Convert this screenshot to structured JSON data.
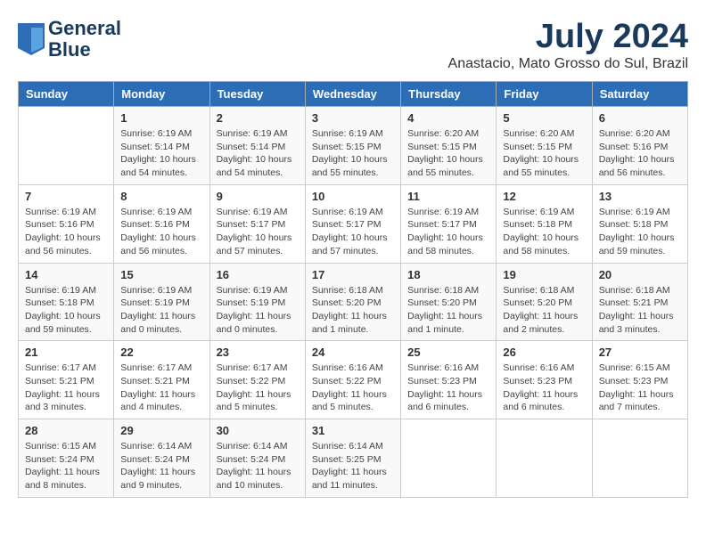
{
  "header": {
    "logo_line1": "General",
    "logo_line2": "Blue",
    "month": "July 2024",
    "location": "Anastacio, Mato Grosso do Sul, Brazil"
  },
  "columns": [
    "Sunday",
    "Monday",
    "Tuesday",
    "Wednesday",
    "Thursday",
    "Friday",
    "Saturday"
  ],
  "weeks": [
    [
      {
        "day": "",
        "sunrise": "",
        "sunset": "",
        "daylight": ""
      },
      {
        "day": "1",
        "sunrise": "Sunrise: 6:19 AM",
        "sunset": "Sunset: 5:14 PM",
        "daylight": "Daylight: 10 hours and 54 minutes."
      },
      {
        "day": "2",
        "sunrise": "Sunrise: 6:19 AM",
        "sunset": "Sunset: 5:14 PM",
        "daylight": "Daylight: 10 hours and 54 minutes."
      },
      {
        "day": "3",
        "sunrise": "Sunrise: 6:19 AM",
        "sunset": "Sunset: 5:15 PM",
        "daylight": "Daylight: 10 hours and 55 minutes."
      },
      {
        "day": "4",
        "sunrise": "Sunrise: 6:20 AM",
        "sunset": "Sunset: 5:15 PM",
        "daylight": "Daylight: 10 hours and 55 minutes."
      },
      {
        "day": "5",
        "sunrise": "Sunrise: 6:20 AM",
        "sunset": "Sunset: 5:15 PM",
        "daylight": "Daylight: 10 hours and 55 minutes."
      },
      {
        "day": "6",
        "sunrise": "Sunrise: 6:20 AM",
        "sunset": "Sunset: 5:16 PM",
        "daylight": "Daylight: 10 hours and 56 minutes."
      }
    ],
    [
      {
        "day": "7",
        "sunrise": "Sunrise: 6:19 AM",
        "sunset": "Sunset: 5:16 PM",
        "daylight": "Daylight: 10 hours and 56 minutes."
      },
      {
        "day": "8",
        "sunrise": "Sunrise: 6:19 AM",
        "sunset": "Sunset: 5:16 PM",
        "daylight": "Daylight: 10 hours and 56 minutes."
      },
      {
        "day": "9",
        "sunrise": "Sunrise: 6:19 AM",
        "sunset": "Sunset: 5:17 PM",
        "daylight": "Daylight: 10 hours and 57 minutes."
      },
      {
        "day": "10",
        "sunrise": "Sunrise: 6:19 AM",
        "sunset": "Sunset: 5:17 PM",
        "daylight": "Daylight: 10 hours and 57 minutes."
      },
      {
        "day": "11",
        "sunrise": "Sunrise: 6:19 AM",
        "sunset": "Sunset: 5:17 PM",
        "daylight": "Daylight: 10 hours and 58 minutes."
      },
      {
        "day": "12",
        "sunrise": "Sunrise: 6:19 AM",
        "sunset": "Sunset: 5:18 PM",
        "daylight": "Daylight: 10 hours and 58 minutes."
      },
      {
        "day": "13",
        "sunrise": "Sunrise: 6:19 AM",
        "sunset": "Sunset: 5:18 PM",
        "daylight": "Daylight: 10 hours and 59 minutes."
      }
    ],
    [
      {
        "day": "14",
        "sunrise": "Sunrise: 6:19 AM",
        "sunset": "Sunset: 5:18 PM",
        "daylight": "Daylight: 10 hours and 59 minutes."
      },
      {
        "day": "15",
        "sunrise": "Sunrise: 6:19 AM",
        "sunset": "Sunset: 5:19 PM",
        "daylight": "Daylight: 11 hours and 0 minutes."
      },
      {
        "day": "16",
        "sunrise": "Sunrise: 6:19 AM",
        "sunset": "Sunset: 5:19 PM",
        "daylight": "Daylight: 11 hours and 0 minutes."
      },
      {
        "day": "17",
        "sunrise": "Sunrise: 6:18 AM",
        "sunset": "Sunset: 5:20 PM",
        "daylight": "Daylight: 11 hours and 1 minute."
      },
      {
        "day": "18",
        "sunrise": "Sunrise: 6:18 AM",
        "sunset": "Sunset: 5:20 PM",
        "daylight": "Daylight: 11 hours and 1 minute."
      },
      {
        "day": "19",
        "sunrise": "Sunrise: 6:18 AM",
        "sunset": "Sunset: 5:20 PM",
        "daylight": "Daylight: 11 hours and 2 minutes."
      },
      {
        "day": "20",
        "sunrise": "Sunrise: 6:18 AM",
        "sunset": "Sunset: 5:21 PM",
        "daylight": "Daylight: 11 hours and 3 minutes."
      }
    ],
    [
      {
        "day": "21",
        "sunrise": "Sunrise: 6:17 AM",
        "sunset": "Sunset: 5:21 PM",
        "daylight": "Daylight: 11 hours and 3 minutes."
      },
      {
        "day": "22",
        "sunrise": "Sunrise: 6:17 AM",
        "sunset": "Sunset: 5:21 PM",
        "daylight": "Daylight: 11 hours and 4 minutes."
      },
      {
        "day": "23",
        "sunrise": "Sunrise: 6:17 AM",
        "sunset": "Sunset: 5:22 PM",
        "daylight": "Daylight: 11 hours and 5 minutes."
      },
      {
        "day": "24",
        "sunrise": "Sunrise: 6:16 AM",
        "sunset": "Sunset: 5:22 PM",
        "daylight": "Daylight: 11 hours and 5 minutes."
      },
      {
        "day": "25",
        "sunrise": "Sunrise: 6:16 AM",
        "sunset": "Sunset: 5:23 PM",
        "daylight": "Daylight: 11 hours and 6 minutes."
      },
      {
        "day": "26",
        "sunrise": "Sunrise: 6:16 AM",
        "sunset": "Sunset: 5:23 PM",
        "daylight": "Daylight: 11 hours and 6 minutes."
      },
      {
        "day": "27",
        "sunrise": "Sunrise: 6:15 AM",
        "sunset": "Sunset: 5:23 PM",
        "daylight": "Daylight: 11 hours and 7 minutes."
      }
    ],
    [
      {
        "day": "28",
        "sunrise": "Sunrise: 6:15 AM",
        "sunset": "Sunset: 5:24 PM",
        "daylight": "Daylight: 11 hours and 8 minutes."
      },
      {
        "day": "29",
        "sunrise": "Sunrise: 6:14 AM",
        "sunset": "Sunset: 5:24 PM",
        "daylight": "Daylight: 11 hours and 9 minutes."
      },
      {
        "day": "30",
        "sunrise": "Sunrise: 6:14 AM",
        "sunset": "Sunset: 5:24 PM",
        "daylight": "Daylight: 11 hours and 10 minutes."
      },
      {
        "day": "31",
        "sunrise": "Sunrise: 6:14 AM",
        "sunset": "Sunset: 5:25 PM",
        "daylight": "Daylight: 11 hours and 11 minutes."
      },
      {
        "day": "",
        "sunrise": "",
        "sunset": "",
        "daylight": ""
      },
      {
        "day": "",
        "sunrise": "",
        "sunset": "",
        "daylight": ""
      },
      {
        "day": "",
        "sunrise": "",
        "sunset": "",
        "daylight": ""
      }
    ]
  ]
}
